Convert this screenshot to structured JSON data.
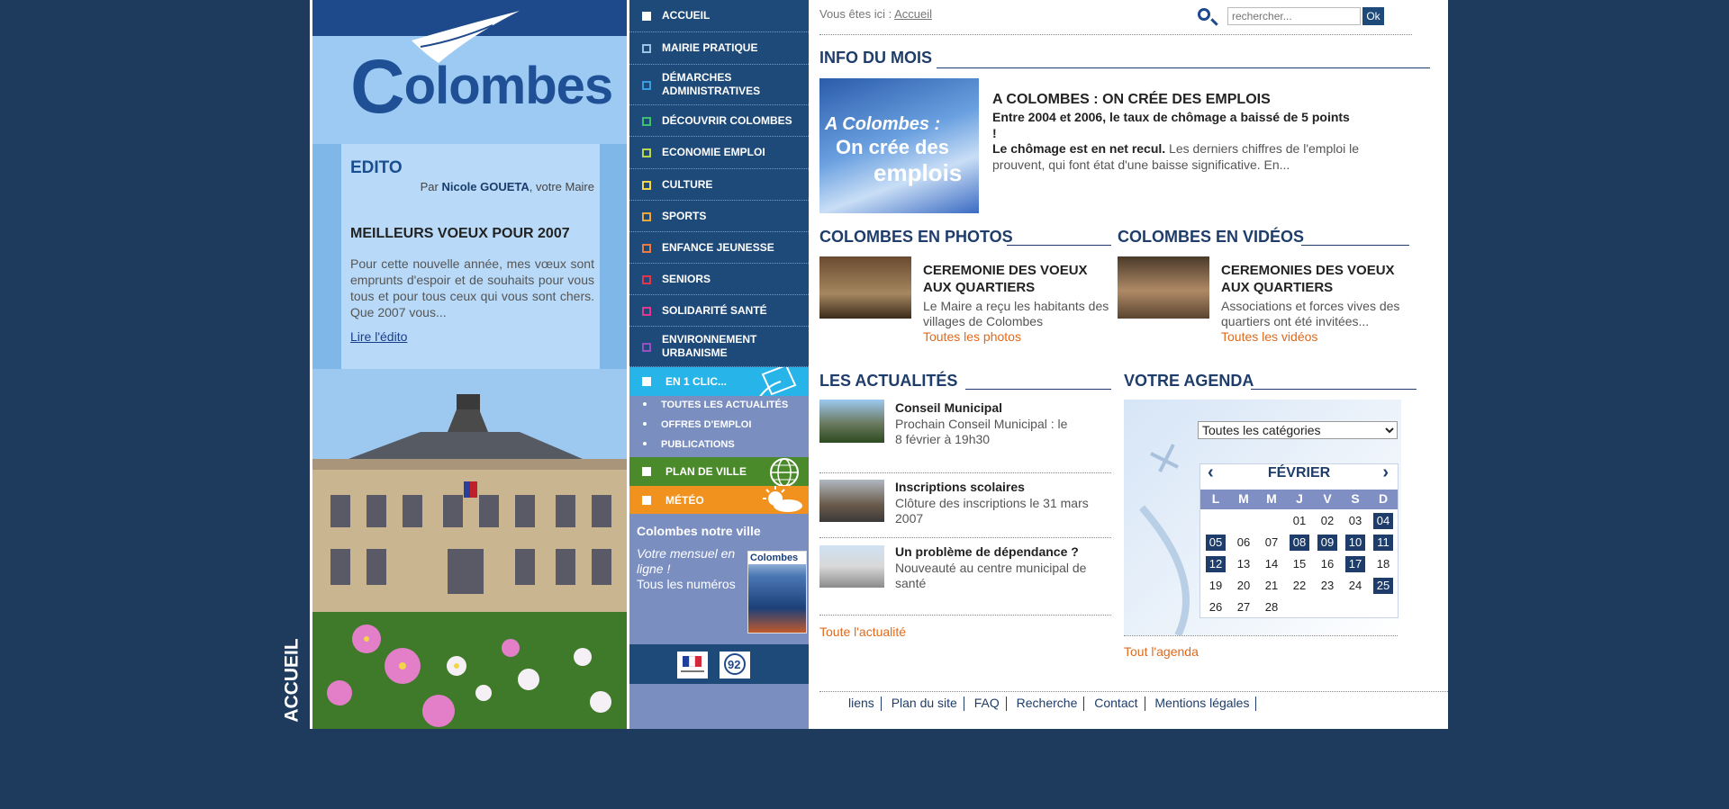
{
  "side_label": "ACCUEIL",
  "logo": {
    "text": "olombes",
    "initial": "C"
  },
  "edito": {
    "title": "EDITO",
    "by_prefix": "Par ",
    "by_name": "Nicole GOUETA",
    "by_suffix": ", votre Maire",
    "headline": "MEILLEURS VOEUX POUR 2007",
    "text": "Pour cette nouvelle année, mes vœux sont emprunts d'espoir et de souhaits pour vous tous et pour tous ceux qui vous sont chers. Que 2007 vous...",
    "link": "Lire l'édito"
  },
  "nav": {
    "items": [
      {
        "label": "ACCUEIL",
        "color": "#ffffff"
      },
      {
        "label": "MAIRIE PRATIQUE",
        "color": "#9dc3e8"
      },
      {
        "label": "DÉMARCHES ADMINISTRATIVES",
        "color": "#3a9be0"
      },
      {
        "label": "DÉCOUVRIR COLOMBES",
        "color": "#3cbf6e"
      },
      {
        "label": "ECONOMIE EMPLOI",
        "color": "#b7d64a"
      },
      {
        "label": "CULTURE",
        "color": "#f2d548"
      },
      {
        "label": "SPORTS",
        "color": "#f2a63a"
      },
      {
        "label": "ENFANCE JEUNESSE",
        "color": "#f07a3c"
      },
      {
        "label": "SENIORS",
        "color": "#e8334a"
      },
      {
        "label": "SOLIDARITÉ SANTÉ",
        "color": "#e2368f"
      },
      {
        "label": "ENVIRONNEMENT URBANISME",
        "color": "#9a4ec4"
      }
    ],
    "en1clic": "EN 1 CLIC...",
    "sub_items": [
      "TOUTES LES ACTUALITÉS",
      "OFFRES D'EMPLOI",
      "PUBLICATIONS"
    ],
    "plan": "PLAN DE VILLE",
    "meteo": "MÉTÉO",
    "mag_title": "Colombes notre ville",
    "mag_sub": "Votre mensuel en ligne !",
    "mag_all": "Tous les numéros",
    "mag_cover_title": "Colombes"
  },
  "breadcrumb": {
    "prefix": "Vous êtes ici : ",
    "link": "Accueil"
  },
  "search": {
    "placeholder": "rechercher...",
    "button": "Ok"
  },
  "info": {
    "section": "INFO DU MOIS",
    "img_line1": "A Colombes :",
    "img_line2": "On crée des",
    "img_line3": "emplois",
    "title": "A COLOMBES : ON CRÉE DES EMPLOIS",
    "subtitle": "Entre 2004 et 2006, le taux de chômage a baissé de 5 points !",
    "bold": "Le chômage est en net recul.",
    "text": " Les derniers chiffres de l'emploi le prouvent, qui font état d'une baisse significative. En..."
  },
  "photos": {
    "section": "COLOMBES EN PHOTOS",
    "title": "CEREMONIE DES VOEUX AUX QUARTIERS",
    "text": "Le Maire a reçu les habitants des villages de Colombes",
    "link": "Toutes les photos"
  },
  "videos": {
    "section": "COLOMBES EN VIDÉOS",
    "title": "CEREMONIES DES VOEUX AUX QUARTIERS",
    "text": "Associations et forces vives des quartiers ont été invitées...",
    "link": "Toutes les vidéos"
  },
  "news": {
    "section": "LES ACTUALITÉS",
    "items": [
      {
        "title": "Conseil Municipal",
        "text": "Prochain Conseil Municipal : le 8 février à 19h30"
      },
      {
        "title": "Inscriptions scolaires",
        "text": "Clôture des inscriptions le 31 mars 2007"
      },
      {
        "title": "Un problème de dépendance ?",
        "text": "Nouveauté au centre municipal de santé"
      }
    ],
    "link": "Toute l'actualité"
  },
  "agenda": {
    "section": "VOTRE AGENDA",
    "category": "Toutes les catégories",
    "month": "FÉVRIER",
    "prev": "‹",
    "next": "›",
    "day_names": [
      "L",
      "M",
      "M",
      "J",
      "V",
      "S",
      "D"
    ],
    "link": "Tout l'agenda"
  },
  "footer": [
    "liens",
    "Plan du site",
    "FAQ",
    "Recherche",
    "Contact",
    "Mentions légales"
  ]
}
